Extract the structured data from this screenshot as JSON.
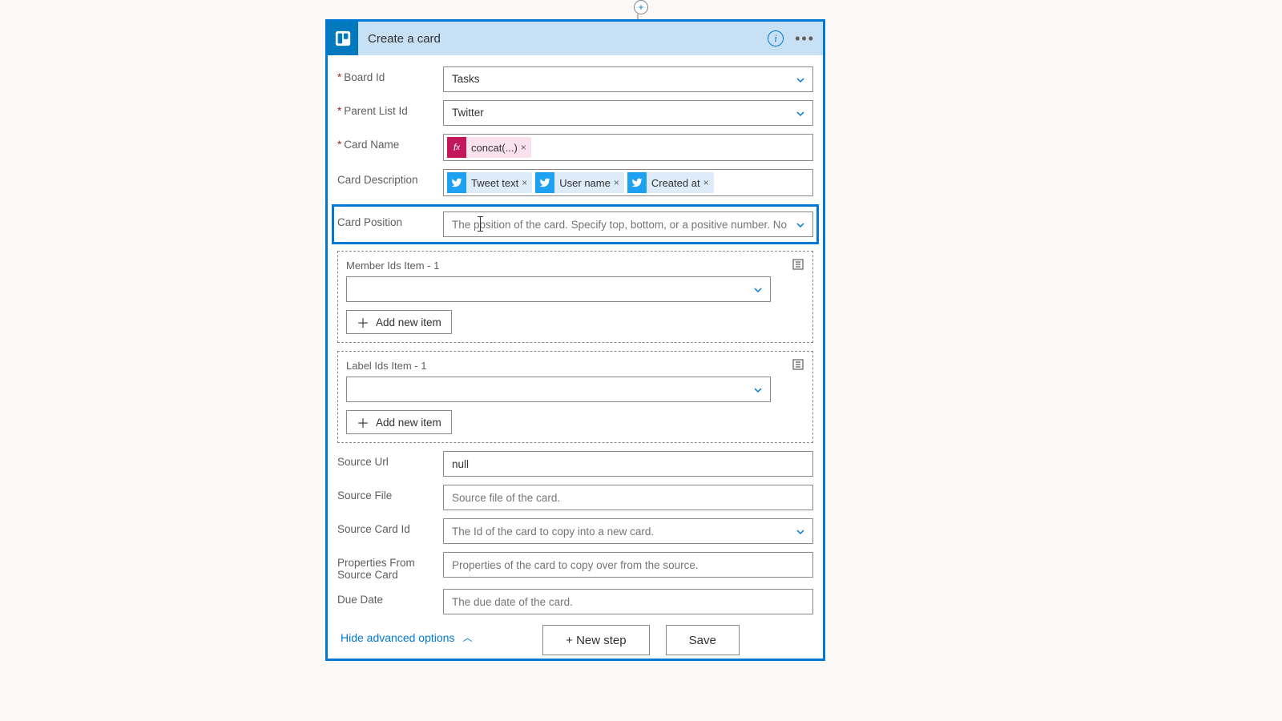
{
  "header": {
    "title": "Create a card"
  },
  "fields": {
    "boardId": {
      "label": "Board Id",
      "value": "Tasks",
      "required": true
    },
    "parentListId": {
      "label": "Parent List Id",
      "value": "Twitter",
      "required": true
    },
    "cardName": {
      "label": "Card Name",
      "required": true,
      "token_fx": "concat(...)"
    },
    "cardDescription": {
      "label": "Card Description",
      "tokens": [
        "Tweet text",
        "User name",
        "Created at"
      ]
    },
    "cardPosition": {
      "label": "Card Position",
      "placeholder": "The position of the card. Specify top, bottom, or a positive number. Note"
    },
    "memberIds": {
      "label": "Member Ids Item - 1",
      "add": "Add new item"
    },
    "labelIds": {
      "label": "Label Ids Item - 1",
      "add": "Add new item"
    },
    "sourceUrl": {
      "label": "Source Url",
      "value": "null"
    },
    "sourceFile": {
      "label": "Source File",
      "placeholder": "Source file of the card."
    },
    "sourceCardId": {
      "label": "Source Card Id",
      "placeholder": "The Id of the card to copy into a new card."
    },
    "properties": {
      "label": "Properties From Source Card",
      "placeholder": "Properties of the card to copy over from the source."
    },
    "dueDate": {
      "label": "Due Date",
      "placeholder": "The due date of the card."
    }
  },
  "hideAdvanced": "Hide advanced options",
  "footer": {
    "newStep": "+ New step",
    "save": "Save"
  }
}
